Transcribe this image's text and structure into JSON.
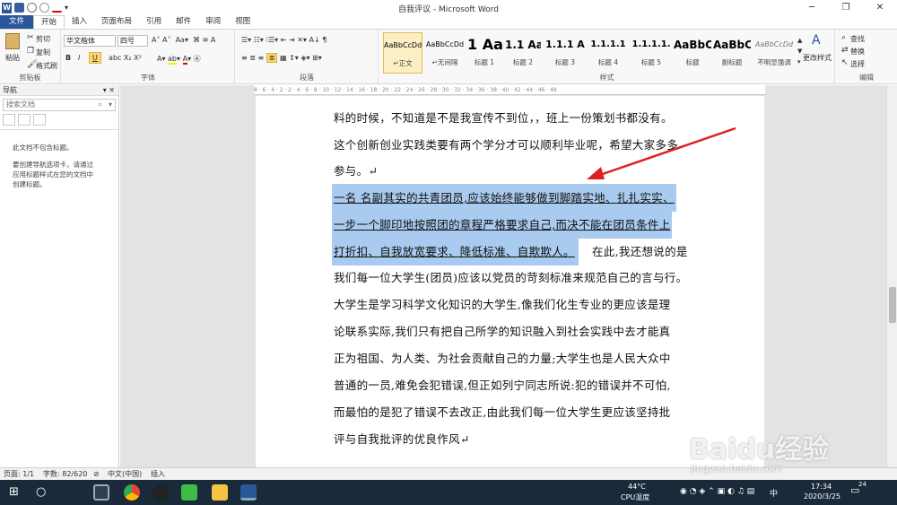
{
  "window": {
    "title": "自我评议 - Microsoft Word"
  },
  "tabs": [
    "文件",
    "开始",
    "插入",
    "页面布局",
    "引用",
    "邮件",
    "审阅",
    "视图"
  ],
  "ribbon": {
    "clipboard": {
      "paste": "粘贴",
      "cut": "剪切",
      "copy": "复制",
      "format_painter": "格式刷",
      "label": "剪贴板"
    },
    "font": {
      "name": "华文楷体",
      "size": "四号",
      "label": "字体"
    },
    "paragraph": {
      "label": "段落"
    },
    "styles": {
      "label": "样式",
      "items": [
        {
          "sample": "AaBbCcDd",
          "name": "↵正文"
        },
        {
          "sample": "AaBbCcDd",
          "name": "↵无间隔"
        },
        {
          "sample": "1 Aa",
          "name": "标题 1"
        },
        {
          "sample": "1.1 Aa",
          "name": "标题 2"
        },
        {
          "sample": "1.1.1 A",
          "name": "标题 3"
        },
        {
          "sample": "1.1.1.1",
          "name": "标题 4"
        },
        {
          "sample": "1.1.1.1.",
          "name": "标题 5"
        },
        {
          "sample": "AaBbC",
          "name": "标题"
        },
        {
          "sample": "AaBbC",
          "name": "副标题"
        },
        {
          "sample": "AaBbCcDd",
          "name": "不明显强调"
        }
      ],
      "change_styles": "更改样式"
    },
    "editing": {
      "find": "查找",
      "replace": "替换",
      "select": "选择",
      "label": "编辑"
    }
  },
  "nav": {
    "title": "导航",
    "search_placeholder": "搜索文档",
    "msg1": "此文档不包含标题。",
    "msg2": "要创建导航选项卡，请通过应用标题样式在您的文档中创建标题。"
  },
  "ruler": "8 · 6 · 4 · 2 · 2 · 4 · 6 · 8 · 10 · 12 · 14 · 16 · 18 · 20 · 22 · 24 · 26 · 28 · 30 · 32 · 34 · 36 · 38 · 40 · 42 · 44 · 46 · 48",
  "document": {
    "lines": [
      "料的时候，不知道是不是我宣传不到位，，班上一份策划书都没有。",
      "这个创新创业实践类要有两个学分才可以顺利毕业呢，希望大家多多",
      "参与。↵",
      "一名 名副其实的共青团员,应该始终能够做到脚踏实地、扎扎实实、",
      "一步一个脚印地按照团的章程严格要求自己,而决不能在团员条件上",
      "打折扣、自我放宽要求、降低标准、自欺欺人。",
      "在此,我还想说的是",
      "我们每一位大学生(团员)应该以党员的苛刻标准来规范自己的言与行。",
      "大学生是学习科学文化知识的大学生,像我们化生专业的更应该是理",
      "论联系实际,我们只有把自己所学的知识融入到社会实践中去才能真",
      "正为祖国、为人类、为社会贡献自己的力量;大学生也是人民大众中",
      "普通的一员,难免会犯错误,但正如列宁同志所说:犯的错误并不可怕,",
      "而最怕的是犯了错误不去改正,由此我们每一位大学生更应该坚持批",
      "评与自我批评的优良作风↵"
    ]
  },
  "status": {
    "page": "页面: 1/1",
    "words": "字数: 82/620",
    "lang": "中文(中国)",
    "mode": "插入"
  },
  "taskbar": {
    "temp": "44°C",
    "temp_label": "CPU温度",
    "time": "17:34",
    "date": "2020/3/25",
    "ime": "中",
    "badge": "24"
  },
  "watermark": {
    "brand": "Baidu经验",
    "url": "jingyan.baidu.com"
  },
  "colors": {
    "word_blue": "#2b579a",
    "highlight": "#a9cbef",
    "arrow": "#e02020"
  }
}
